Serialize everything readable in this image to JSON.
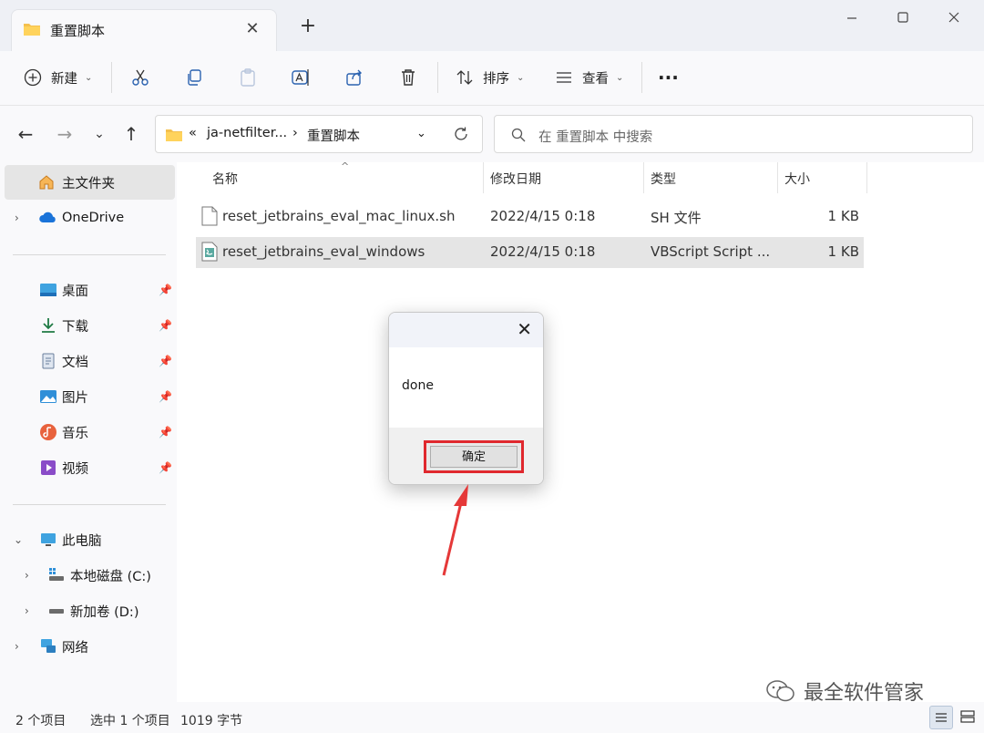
{
  "tab": {
    "title": "重置脚本"
  },
  "toolbar": {
    "new_label": "新建",
    "sort_label": "排序",
    "view_label": "查看",
    "more_label": "···"
  },
  "address": {
    "overflow": "«",
    "seg1": "ja-netfilter...",
    "sep": "›",
    "seg2": "重置脚本",
    "search_placeholder": "在 重置脚本 中搜索"
  },
  "sidebar": {
    "home": "主文件夹",
    "onedrive": "OneDrive",
    "quick": [
      {
        "label": "桌面"
      },
      {
        "label": "下载"
      },
      {
        "label": "文档"
      },
      {
        "label": "图片"
      },
      {
        "label": "音乐"
      },
      {
        "label": "视频"
      }
    ],
    "thispc": "此电脑",
    "drive_c": "本地磁盘 (C:)",
    "drive_d": "新加卷 (D:)",
    "network": "网络"
  },
  "columns": {
    "name": "名称",
    "date": "修改日期",
    "type": "类型",
    "size": "大小"
  },
  "files": [
    {
      "name": "reset_jetbrains_eval_mac_linux.sh",
      "date": "2022/4/15 0:18",
      "type": "SH 文件",
      "size": "1 KB"
    },
    {
      "name": "reset_jetbrains_eval_windows",
      "date": "2022/4/15 0:18",
      "type": "VBScript Script ...",
      "size": "1 KB"
    }
  ],
  "dialog": {
    "message": "done",
    "ok_label": "确定"
  },
  "status": {
    "items": "2 个项目",
    "selected": "选中 1 个项目",
    "size": "1019 字节"
  },
  "watermark": "最全软件管家",
  "colors": {
    "highlight": "#e0282e",
    "accent": "#0a64c8"
  }
}
